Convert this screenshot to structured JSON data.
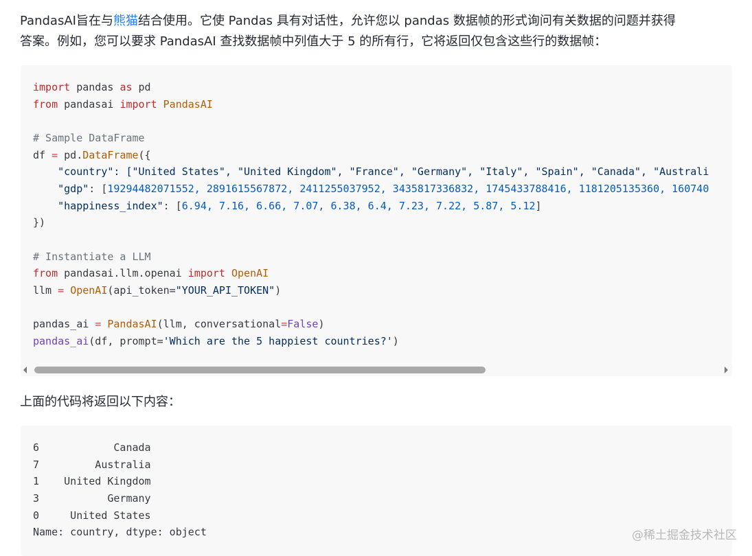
{
  "intro": {
    "line1_before_link": "PandasAI旨在与",
    "link_text": "熊猫",
    "line1_after_link": "结合使用。它使 Pandas 具有对话性，允许您以 pandas 数据帧的形式询问有关数据的问题并获得",
    "line2": "答案。例如，您可以要求 PandasAI 查找数据帧中列值大于 5 的所有行，它将返回仅包含这些行的数据帧："
  },
  "code1": {
    "l1": [
      "import",
      " pandas ",
      "as",
      " pd"
    ],
    "l2": [
      "from",
      " pandasai ",
      "import",
      " ",
      "PandasAI"
    ],
    "l4": "# Sample DataFrame",
    "l5": [
      "df ",
      "=",
      " pd.",
      "DataFrame",
      "({"
    ],
    "l6_key": "\"country\"",
    "l6_vals": ": [\"United States\", \"United Kingdom\", \"France\", \"Germany\", \"Italy\", \"Spain\", \"Canada\", \"Australi",
    "l7_key": "\"gdp\"",
    "l7_pre": ": [",
    "l7_vals": "19294482071552, 2891615567872, 2411255037952, 3435817336832, 1745433788416, 1181205135360, 160740",
    "l8_key": "\"happiness_index\"",
    "l8_pre": ": [",
    "l8_vals": "6.94, 7.16, 6.66, 7.07, 6.38, 6.4, 7.23, 7.22, 5.87, 5.12",
    "l8_post": "]",
    "l9": "})",
    "l11": "# Instantiate a LLM",
    "l12": [
      "from",
      " pandasai.llm.openai ",
      "import",
      " ",
      "OpenAI"
    ],
    "l13": [
      "llm ",
      "=",
      " ",
      "OpenAI",
      "(api_token=",
      "\"YOUR_API_TOKEN\"",
      ")"
    ],
    "l15": [
      "pandas_ai ",
      "=",
      " ",
      "PandasAI",
      "(llm, conversational",
      "=",
      "False",
      ")"
    ],
    "l16": [
      "pandas_ai",
      "(df, prompt=",
      "'Which are the 5 happiest countries?'",
      ")"
    ]
  },
  "result_intro": "上面的代码将返回以下内容：",
  "output": {
    "rows": [
      "6            Canada",
      "7         Australia",
      "1    United Kingdom",
      "3           Germany",
      "0     United States"
    ],
    "footer": "Name: country, dtype: object"
  },
  "watermark": "@稀土掘金技术社区"
}
